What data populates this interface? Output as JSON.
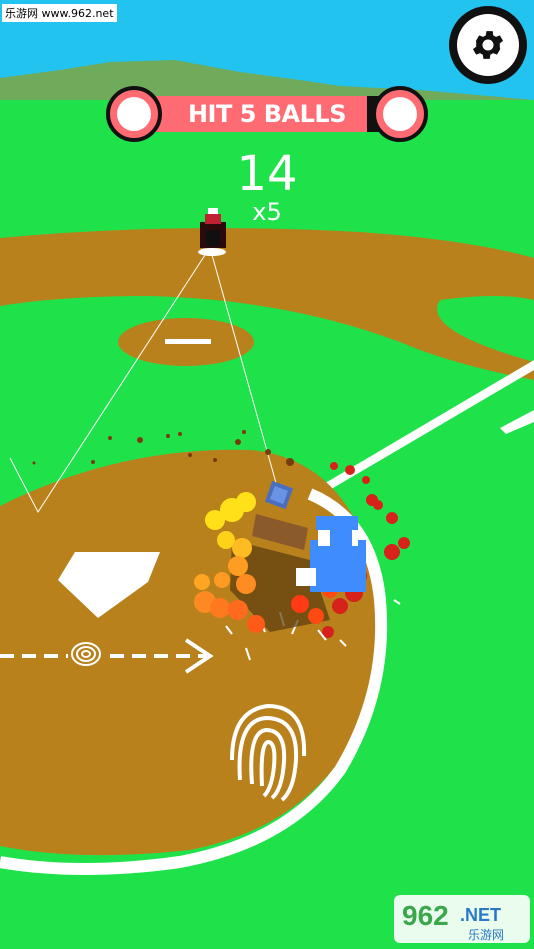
{
  "watermark_top": "乐游网 www.962.net",
  "goal": {
    "label": "HIT 5 BALLS",
    "progress": 0.88
  },
  "score": {
    "value": "14",
    "multiplier": "x5"
  },
  "settings": {
    "icon": "gear-icon"
  },
  "swipe_hint": {
    "arrow_icon": "swipe-arrow-icon",
    "icon": "fingerprint-icon"
  },
  "watermark_bottom": {
    "brand": "962",
    "suffix": ".NET",
    "caption": "乐游网"
  },
  "colors": {
    "grass": "#1fe24a",
    "dirt": "#b8811c",
    "sky": "#23c3f0",
    "accent": "#ff6b73",
    "bar": "#111111",
    "lines": "#ffffff"
  }
}
